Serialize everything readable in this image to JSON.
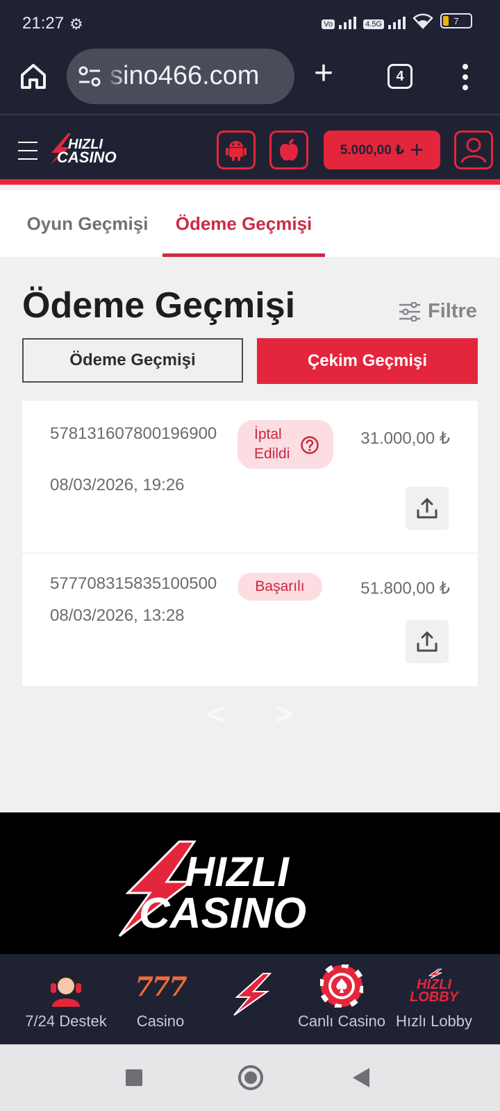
{
  "status_bar": {
    "time": "21:27",
    "network": "4.5G",
    "battery": "7"
  },
  "browser": {
    "url": "sino466.com",
    "tab_count": "4"
  },
  "header": {
    "balance": "5.000,00 ₺",
    "accent_color": "#e4263c",
    "background_color": "#1f2233"
  },
  "tabs": [
    {
      "label": "Oyun Geçmişi",
      "active": false
    },
    {
      "label": "Ödeme Geçmişi",
      "active": true
    }
  ],
  "main": {
    "title": "Ödeme Geçmişi",
    "filter_label": "Filtre",
    "segment_left": "Ödeme Geçmişi",
    "segment_right": "Çekim Geçmişi"
  },
  "transactions": [
    {
      "id": "578131607800196900",
      "status_line1": "İptal",
      "status_line2": "Edildi",
      "amount": "31.000,00 ₺",
      "date": "08/03/2026, 19:26"
    },
    {
      "id": "577708315835100500",
      "status": "Başarılı",
      "amount": "51.800,00 ₺",
      "date": "08/03/2026, 13:28"
    }
  ],
  "pager": {
    "prev": "<",
    "next": ">"
  },
  "bottom_nav": [
    {
      "label": "7/24 Destek",
      "icon": "support-agent-icon"
    },
    {
      "label": "Casino",
      "icon": "slot-777-icon",
      "mark": "777"
    },
    {
      "label": "",
      "icon": "lightning-logo-icon"
    },
    {
      "label": "Canlı Casino",
      "icon": "poker-chip-icon"
    },
    {
      "label": "Hızlı Lobby",
      "icon": "hizli-lobby-icon",
      "mark_top": "HIZLI",
      "mark_bottom": "LOBBY"
    }
  ]
}
